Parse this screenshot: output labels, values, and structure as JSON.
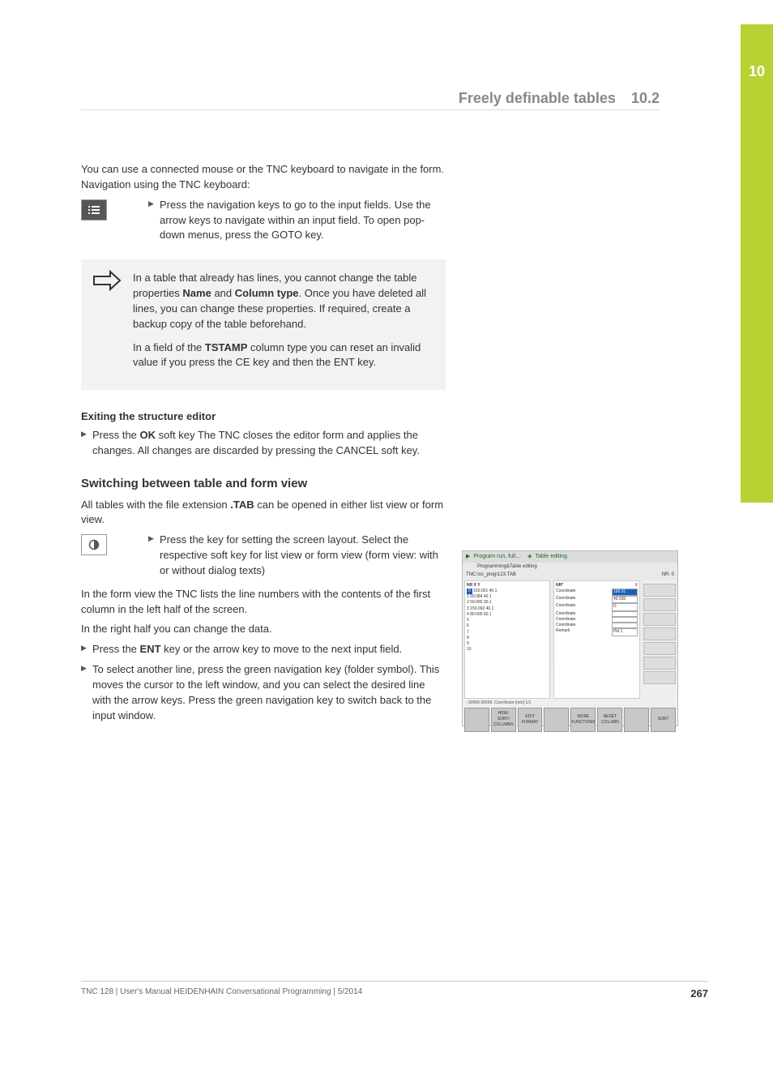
{
  "chapter_number": "10",
  "header": {
    "title": "Freely definable tables",
    "section": "10.2"
  },
  "intro": "You can use a connected mouse or the TNC keyboard to navigate in the form. Navigation using the TNC keyboard:",
  "navkeys_bullet": "Press the navigation keys to go to the input fields. Use the arrow keys to navigate within an input field. To open pop-down menus, press the GOTO key.",
  "note": {
    "p1_pre": "In a table that already has lines, you cannot change the table properties ",
    "p1_b1": "Name",
    "p1_mid": " and ",
    "p1_b2": "Column type",
    "p1_post": ". Once you have deleted all lines, you can change these properties. If required, create a backup copy of the table beforehand.",
    "p2_pre": "In a field of the ",
    "p2_b1": "TSTAMP",
    "p2_post": " column type you can reset an invalid value if you press the CE key and then the ENT key."
  },
  "exit_heading": "Exiting the structure editor",
  "exit_bullet_pre": "Press the ",
  "exit_bullet_b": "OK",
  "exit_bullet_post": " soft key The TNC closes the editor form and applies the changes. All changes are discarded by pressing the CANCEL soft key.",
  "section2_heading": "Switching between table and form view",
  "section2_intro_pre": "All tables with the file extension ",
  "section2_intro_b": ".TAB",
  "section2_intro_post": " can be opened in either list view or form view.",
  "layout_bullet": "Press the key for setting the screen layout. Select the respective soft key for list view or form view (form view: with or without dialog texts)",
  "formview_p1": "In the form view the TNC lists the line numbers with the contents of the first column in the left half of the screen.",
  "formview_p2": "In the right half you can change the data.",
  "bullet_ent_pre": "Press the ",
  "bullet_ent_b": "ENT",
  "bullet_ent_post": " key or the arrow key to move to the next input field.",
  "bullet_navgrn": "To select another line, press the green navigation key (folder symbol). This moves the cursor to the left window, and you can select the desired line with the arrow keys. Press the green navigation key to switch back to the input window.",
  "screenshot": {
    "title_left": "Program run, full…",
    "title_right": "Table editing",
    "subtitle": "Programming&Table editing",
    "path": "TNC:\\nc_prog\\123.TAB",
    "nr_label": "NR: 0",
    "left_cols": "NR      X          Y",
    "left_rows": [
      "0   150.091   40.1",
      "1    50.084   40.1",
      "2    50.090   30.1",
      "3   150.092   40.1",
      "4    80.000   60.1",
      "5",
      "6",
      "7",
      "8",
      "9",
      "10"
    ],
    "mid_header": "NR*",
    "mid_rows": [
      "Coordinate",
      "Coordinate",
      "Coordinate",
      "Coordinate",
      "Coordinate",
      "Coordinate",
      "Remark"
    ],
    "right_vals": [
      "150.01",
      "40.530",
      "D",
      "",
      "",
      "",
      "Pkt 1"
    ],
    "statusbar": "- 99999.99999.  Coordinate [mm]   1/1",
    "softkeys": [
      "",
      "HIDE/ SORT/ COLUMNS",
      "EDIT FORMAT",
      "",
      "MORE FUNCTIONS",
      "RESET COLUMN",
      "",
      "SORT"
    ]
  },
  "footer": {
    "meta": "TNC 128 | User's Manual HEIDENHAIN Conversational Programming | 5/2014",
    "page": "267"
  }
}
